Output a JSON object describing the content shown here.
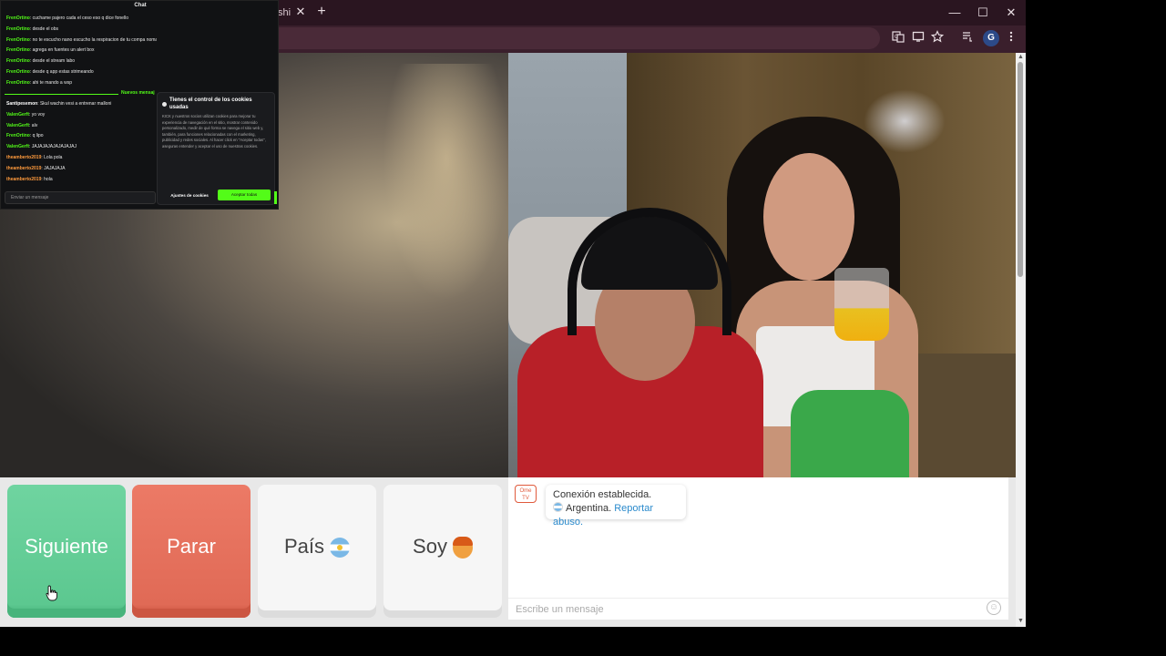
{
  "browser": {
    "tab_fragment": "shi",
    "tab_close": "✕",
    "new_tab": "+",
    "window_controls": {
      "minimize": "—",
      "maximize": "☐",
      "close": "✕"
    },
    "toolbar_icons": [
      "translate-icon",
      "cast-icon",
      "bookmark-star-icon",
      "reading-list-icon",
      "profile-avatar",
      "more-menu-icon"
    ],
    "profile_initial": "G"
  },
  "stream_chat": {
    "title": "Chat",
    "messages_before": [
      {
        "user": "FrenOrtino",
        "color": "#53fc18",
        "text": "cuchame pajero cada el ceso eso q dice fonello"
      },
      {
        "user": "FrenOrtino",
        "color": "#53fc18",
        "text": "desde el obs"
      },
      {
        "user": "FrenOrtino",
        "color": "#53fc18",
        "text": "no te escucho nano escucho la respiracion de tu compa nomas"
      },
      {
        "user": "FrenOrtino",
        "color": "#53fc18",
        "text": "agrega en fuentes un alert box"
      },
      {
        "user": "FrenOrtino",
        "color": "#53fc18",
        "text": "desde el stream labo"
      },
      {
        "user": "FrenOrtino",
        "color": "#53fc18",
        "text": "desde q app estas strimeando"
      },
      {
        "user": "FrenOrtino",
        "color": "#53fc18",
        "text": "ahi te mando a wsp"
      }
    ],
    "new_messages_label": "Nuevos mensaj",
    "messages_after": [
      {
        "user": "Santipesemon",
        "color": "#ffffff",
        "text": "Skul wachin vesi a entrenar malloni"
      },
      {
        "user": "ValenGerft",
        "color": "#53fc18",
        "text": "yo voy"
      },
      {
        "user": "ValenGerft",
        "color": "#53fc18",
        "text": "alv"
      },
      {
        "user": "FrenOrtino",
        "color": "#53fc18",
        "text": "q lipo"
      },
      {
        "user": "ValenGerft",
        "color": "#53fc18",
        "text": "JAJAJAJAJAJAJAJAJ"
      },
      {
        "user": "theamberto2019",
        "color": "#ff9a3c",
        "text": "Lola pola"
      },
      {
        "user": "theamberto2019",
        "color": "#ff9a3c",
        "text": "JAJAJAJA"
      },
      {
        "user": "theamberto2019",
        "color": "#ff9a3c",
        "text": "hola"
      }
    ],
    "input_placeholder": "Enviar un mensaje",
    "cookie": {
      "title": "Tienes el control de los cookies usadas",
      "body": "KICK y nuestros socios utilizan cookies para mejorar tu experiencia de navegación en el sitio, mostrar contenido personalizado, medir de qué forma se navega el sitio web y, también, para funciones relacionadas con el marketing, publicidad y redes sociales. Al hacer click en \"Aceptar todas\", aseguras entender y aceptar el uso de nuestras cookies.",
      "settings_label": "Ajustes de cookies",
      "accept_label": "Aceptar todas"
    }
  },
  "controls": {
    "next_label": "Siguiente",
    "stop_label": "Parar",
    "country_label": "País",
    "gender_label": "Soy"
  },
  "chat": {
    "logo_text": "Ome TV",
    "connection_text": "Conexión establecida.",
    "country_text": "Argentina.",
    "report_link": "Reportar abuso.",
    "input_placeholder": "Escribe un mensaje"
  },
  "colors": {
    "next": "#5cc890",
    "stop": "#e06a56",
    "kick_green": "#53fc18",
    "browser_frame": "#3a1f2c"
  }
}
